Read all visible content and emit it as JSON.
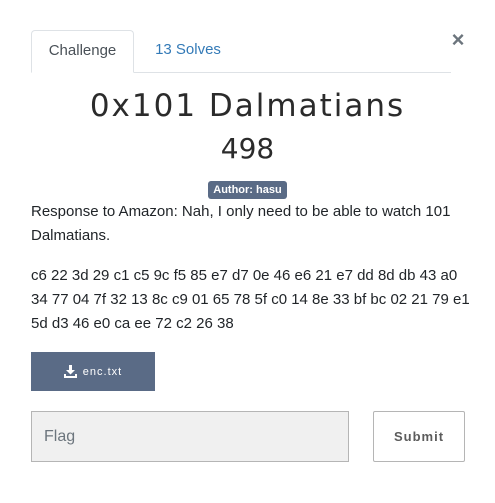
{
  "tabs": [
    {
      "label": "Challenge"
    },
    {
      "label": "13 Solves"
    }
  ],
  "close_label": "×",
  "challenge": {
    "name": "0x101 Dalmatians",
    "points": "498",
    "author_badge": "Author: hasu",
    "description": "Response to Amazon: Nah, I only need to be able to watch 101 Dalmatians.",
    "hex_data": "c6 22 3d 29 c1 c5 9c f5 85 e7 d7 0e 46 e6 21 e7 dd 8d db 43 a0 34 77 04 7f 32 13 8c c9 01 65 78 5f c0 14 8e 33 bf bc 02 21 79 e1 5d d3 46 e0 ca ee 72 c2 26 38",
    "file_label": "enc.txt"
  },
  "flag_input": {
    "placeholder": "Flag",
    "value": ""
  },
  "submit_label": "Submit",
  "icons": {
    "download": "download-icon",
    "close": "close-icon"
  },
  "colors": {
    "tab_link": "#337ab7",
    "badge_bg": "#5a6b86",
    "button_bg": "#5a6b86"
  }
}
